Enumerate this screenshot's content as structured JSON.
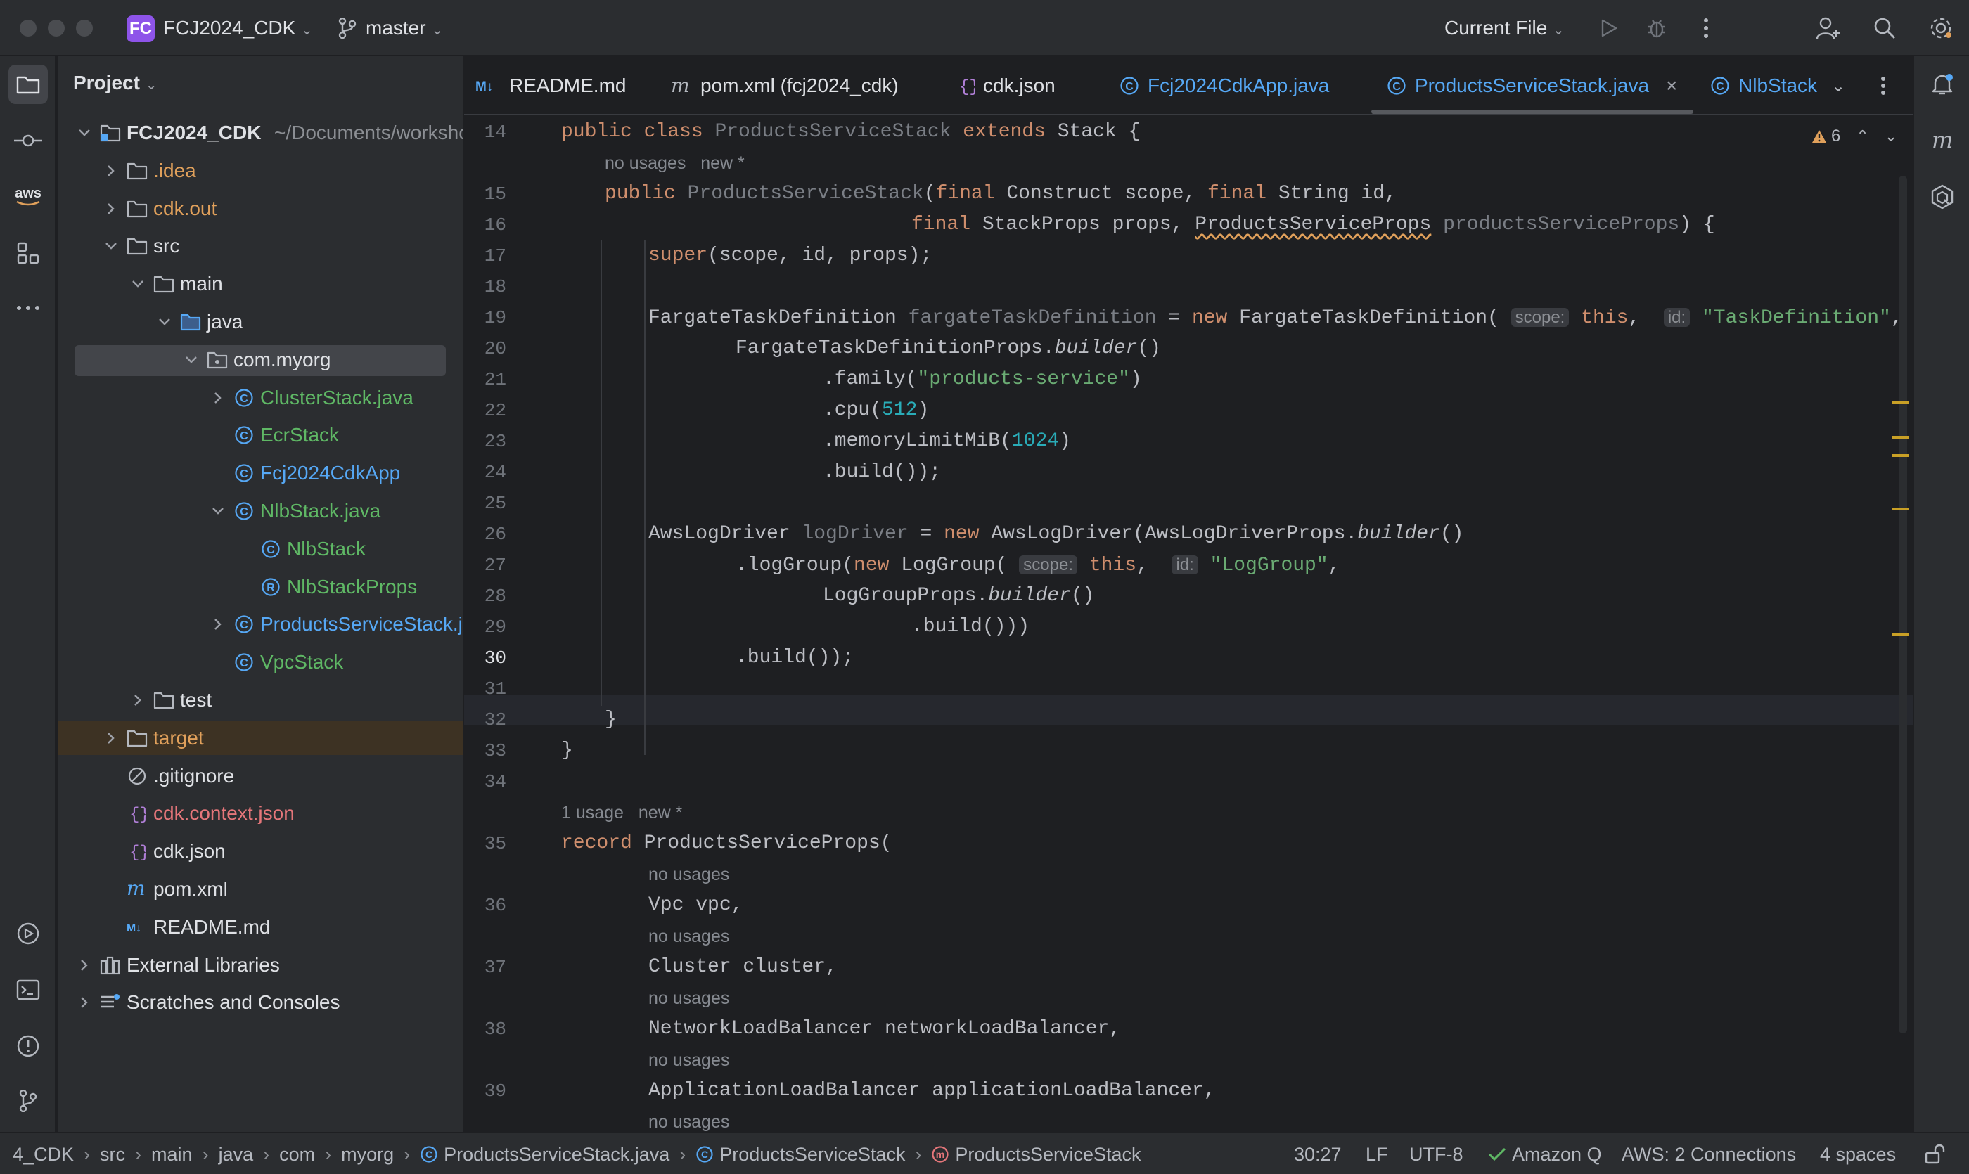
{
  "titlebar": {
    "project_badge": "FC",
    "project_name": "FCJ2024_CDK",
    "branch": "master",
    "run_config": "Current File"
  },
  "project_panel": {
    "header": "Project",
    "tree": [
      {
        "label": "FCJ2024_CDK",
        "path": "~/Documents/workshop",
        "icon": "module-folder-icon"
      },
      {
        "label": ".idea",
        "icon": "folder-icon"
      },
      {
        "label": "cdk.out",
        "icon": "folder-icon"
      },
      {
        "label": "src",
        "icon": "folder-icon"
      },
      {
        "label": "main",
        "icon": "folder-icon"
      },
      {
        "label": "java",
        "icon": "source-folder-icon"
      },
      {
        "label": "com.myorg",
        "icon": "package-icon"
      },
      {
        "label": "ClusterStack.java",
        "icon": "class-icon"
      },
      {
        "label": "EcrStack",
        "icon": "class-icon"
      },
      {
        "label": "Fcj2024CdkApp",
        "icon": "class-icon"
      },
      {
        "label": "NlbStack.java",
        "icon": "class-icon"
      },
      {
        "label": "NlbStack",
        "icon": "class-icon"
      },
      {
        "label": "NlbStackProps",
        "icon": "record-icon"
      },
      {
        "label": "ProductsServiceStack.java",
        "icon": "class-icon"
      },
      {
        "label": "VpcStack",
        "icon": "class-icon"
      },
      {
        "label": "test",
        "icon": "folder-icon"
      },
      {
        "label": "target",
        "icon": "folder-icon"
      },
      {
        "label": ".gitignore",
        "icon": "ignore-file-icon"
      },
      {
        "label": "cdk.context.json",
        "icon": "json-icon"
      },
      {
        "label": "cdk.json",
        "icon": "json-icon"
      },
      {
        "label": "pom.xml",
        "icon": "maven-icon"
      },
      {
        "label": "README.md",
        "icon": "markdown-icon"
      },
      {
        "label": "External Libraries",
        "icon": "library-icon"
      },
      {
        "label": "Scratches and Consoles",
        "icon": "scratches-icon"
      }
    ]
  },
  "tabs": [
    {
      "label": "README.md",
      "icon": "markdown-icon"
    },
    {
      "label": "pom.xml (fcj2024_cdk)",
      "icon": "maven-icon"
    },
    {
      "label": "cdk.json",
      "icon": "json-icon"
    },
    {
      "label": "Fcj2024CdkApp.java",
      "icon": "class-icon"
    },
    {
      "label": "ProductsServiceStack.java",
      "icon": "class-icon",
      "active": true
    },
    {
      "label": "NlbStack",
      "icon": "class-icon"
    }
  ],
  "editor": {
    "warning_count": "6",
    "line_numbers": [
      "14",
      "15",
      "16",
      "17",
      "18",
      "19",
      "20",
      "21",
      "22",
      "23",
      "24",
      "25",
      "26",
      "27",
      "28",
      "29",
      "30",
      "31",
      "32",
      "33",
      "34",
      "35",
      "36",
      "37",
      "38",
      "39"
    ],
    "hints": {
      "no_usages": "no usages",
      "new": "new *",
      "one_usage": "1 usage"
    },
    "inlay": {
      "scope": "scope:",
      "id": "id:"
    },
    "strings": {
      "task_def": "\"TaskDefinition\"",
      "family": "\"products-service\"",
      "log_group": "\"LogGroup\""
    },
    "numbers": {
      "cpu": "512",
      "memory": "1024"
    }
  },
  "statusbar": {
    "breadcrumb": [
      "4_CDK",
      "src",
      "main",
      "java",
      "com",
      "myorg",
      "ProductsServiceStack.java",
      "ProductsServiceStack",
      "ProductsServiceStack"
    ],
    "position": "30:27",
    "line_sep": "LF",
    "encoding": "UTF-8",
    "amazon_q": "Amazon Q",
    "aws": "AWS: 2 Connections",
    "indent": "4 spaces"
  },
  "colors": {
    "background": "#1e1f22",
    "panel": "#2b2d30",
    "keyword": "#cf8e6d",
    "string": "#6aab73",
    "number": "#2aacb8",
    "class_name": "#56a8f5",
    "badge": "#8e54e9"
  }
}
